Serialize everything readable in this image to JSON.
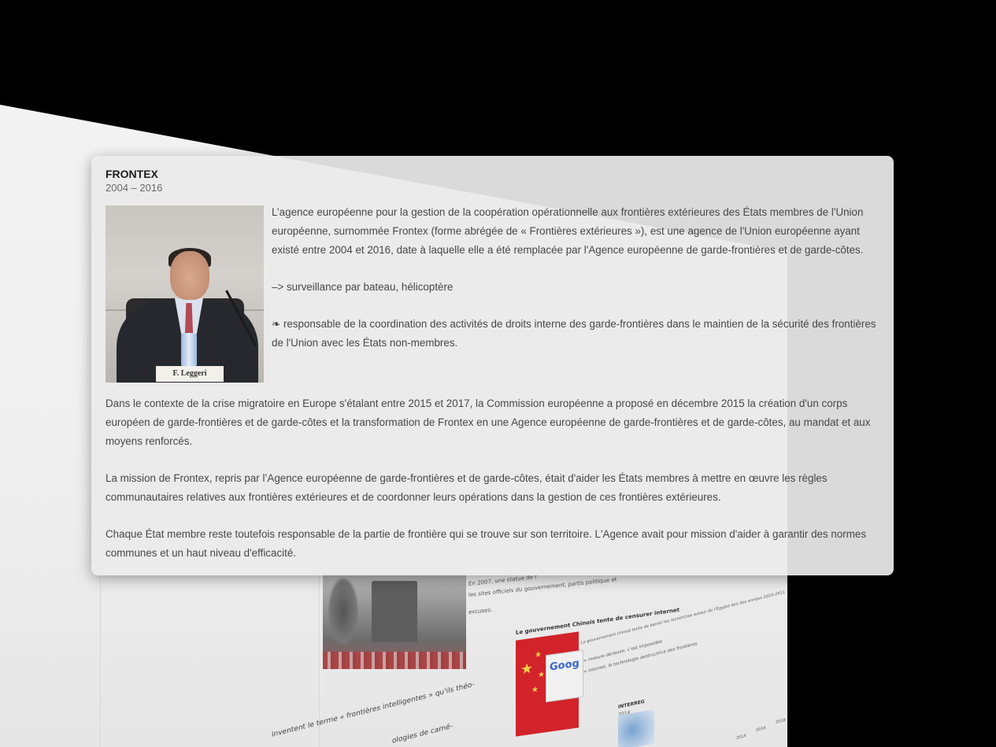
{
  "panel": {
    "title": "FRONTEX",
    "dates": "2004 – 2016",
    "photo_caption": "F. Leggeri",
    "paragraphs": [
      "L’agence européenne pour la gestion de la coopération opérationnelle aux frontières extérieures des États membres de l'Union européenne, surnommée Frontex (forme abrégée de « Frontières extérieures »), est une agence de l'Union européenne ayant existé entre 2004 et 2016, date à laquelle elle a été remplacée par l'Agence européenne de garde-frontières et de garde-côtes.",
      "–> surveillance par bateau, hélicoptère",
      "❧ responsable de la coordination des activités de droits interne des garde-frontières dans le maintien de la sécurité des frontières de l'Union avec les États non-membres.",
      "Dans le contexte de la crise migratoire en Europe s'étalant entre 2015 et 2017, la Commission européenne a proposé en décembre 2015 la création d'un corps européen de garde-frontières et de garde-côtes et la transformation de Frontex en une Agence européenne de garde-frontières et de garde-côtes, au mandat et aux moyens renforcés.",
      "La mission de Frontex, repris par l’Agence européenne de garde-frontières et de garde-côtes, était d'aider les États membres à mettre en œuvre les règles communautaires relatives aux frontières extérieures et de coordonner leurs opérations dans la gestion de ces frontières extérieures.",
      "Chaque État membre reste toutefois responsable de la partie de frontière qui se trouve sur son territoire. L'Agence avait pour mission d'aider à garantir des normes communes et un haut niveau d'efficacité."
    ]
  },
  "background": {
    "event1_text_a": "En 2007, une statue de l'",
    "event1_text_b": "les sites officiels du gouvernement, partis politique et",
    "event1_text_c": "excuses.",
    "event2_title": "Le gouvernement Chinois tente de censurer internet",
    "event2_year": "2011",
    "event2_line1": "Le gouvernement chinois tente de bannir les recherches autour de l'Égypte lors des années 2010-2011",
    "event2_line2": "–> mesure dérisoire, c'est impossible",
    "event2_line3": "–> internet, la technologie destructrice des frontières",
    "event3_title": "INTERREG",
    "event3_year": "2014",
    "bottom_text_1": "inventent le terme « frontières intelligentes » qu'ils théo-",
    "bottom_text_2": "ologies de camé-",
    "axis_labels": [
      "2014",
      "2016",
      "2018"
    ],
    "flag_colors": {
      "red": "#d2232a",
      "star": "#f6d046"
    }
  }
}
